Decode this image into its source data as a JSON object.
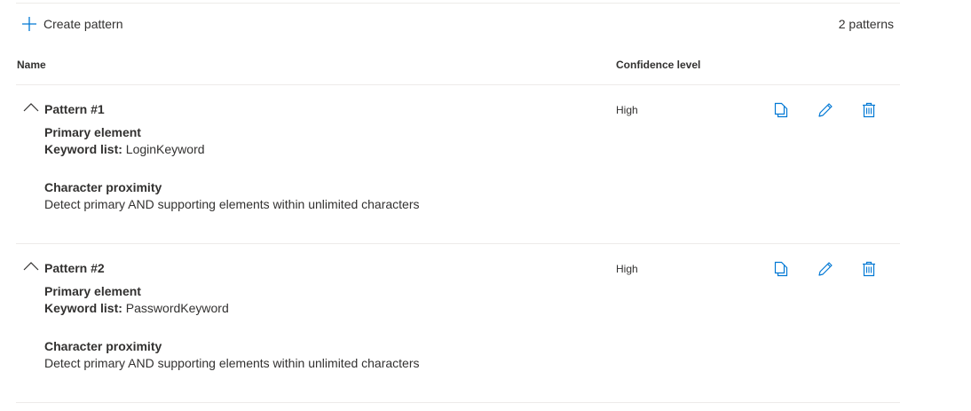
{
  "toolbar": {
    "create_label": "Create pattern",
    "create_icon": "plus-icon",
    "count_label": "2 patterns"
  },
  "table": {
    "columns": {
      "name": "Name",
      "confidence": "Confidence level"
    },
    "rows": [
      {
        "title": "Pattern #1",
        "confidence": "High",
        "primary_heading": "Primary element",
        "keyword_label": "Keyword list:",
        "keyword_value": "LoginKeyword",
        "proximity_heading": "Character proximity",
        "proximity_text": "Detect primary AND supporting elements within unlimited characters"
      },
      {
        "title": "Pattern #2",
        "confidence": "High",
        "primary_heading": "Primary element",
        "keyword_label": "Keyword list:",
        "keyword_value": "PasswordKeyword",
        "proximity_heading": "Character proximity",
        "proximity_text": "Detect primary AND supporting elements within unlimited characters"
      }
    ]
  },
  "icons": {
    "toggle": "chevron-up-icon",
    "copy": "copy-icon",
    "edit": "pencil-icon",
    "delete": "trash-icon"
  },
  "colors": {
    "accent": "#0078d4",
    "text": "#323130",
    "divider": "#edebe9"
  }
}
